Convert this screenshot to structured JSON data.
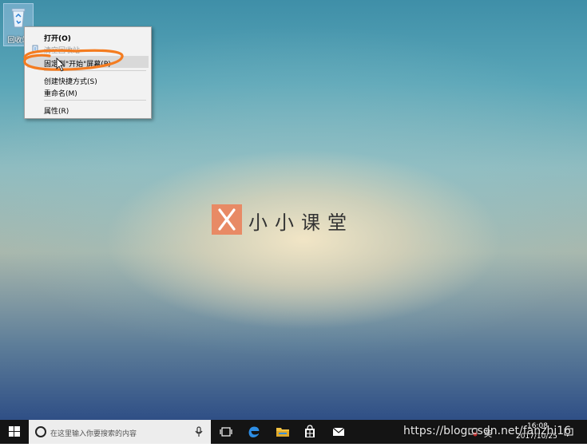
{
  "desktop": {
    "recycle_bin_label": "回收站"
  },
  "context_menu": {
    "items": [
      {
        "label": "打开(O)",
        "style": "bold"
      },
      {
        "label": "清空回收站",
        "style": "disabled"
      },
      {
        "label": "固定到\"开始\"屏幕(P)",
        "style": "hover"
      },
      {
        "label": "创建快捷方式(S)",
        "style": "normal"
      },
      {
        "label": "重命名(M)",
        "style": "normal"
      },
      {
        "label": "属性(R)",
        "style": "normal"
      }
    ]
  },
  "watermark": {
    "text": "小小课堂",
    "color": "#e88a65"
  },
  "taskbar": {
    "search_placeholder": "在这里输入你要搜索的内容",
    "pinned": [
      "task-view-icon",
      "edge-icon",
      "file-explorer-icon",
      "store-icon",
      "mail-icon"
    ],
    "tray": {
      "language": "英",
      "time": "16:08",
      "date": "2017/10/25"
    }
  },
  "overlay": {
    "source_watermark": "https://blog.csdn.net/fanzhi16"
  },
  "colors": {
    "annotation": "#f47c20",
    "taskbar": "#141414"
  }
}
